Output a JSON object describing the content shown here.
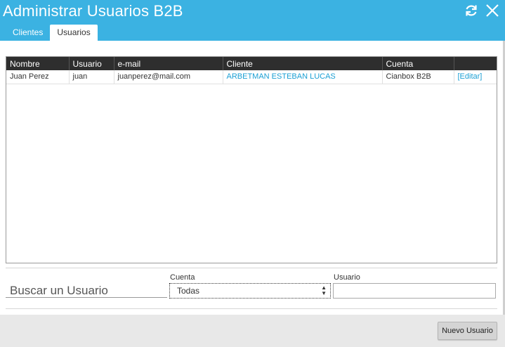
{
  "window": {
    "title": "Administrar Usuarios B2B"
  },
  "icons": {
    "refresh": "refresh-icon",
    "close": "close-icon"
  },
  "tabs": [
    {
      "label": "Clientes",
      "active": false
    },
    {
      "label": "Usuarios",
      "active": true
    }
  ],
  "grid": {
    "columns": [
      "Nombre",
      "Usuario",
      "e-mail",
      "Cliente",
      "Cuenta",
      ""
    ],
    "rows": [
      {
        "nombre": "Juan Perez",
        "usuario": "juan",
        "email": "juanperez@mail.com",
        "cliente": "ARBETMAN ESTEBAN LUCAS",
        "cuenta": "Cianbox B2B",
        "accion": "[Editar]"
      }
    ]
  },
  "search": {
    "label": "Buscar un Usuario",
    "cuenta_label": "Cuenta",
    "cuenta_value": "Todas",
    "usuario_label": "Usuario",
    "usuario_value": ""
  },
  "footer": {
    "nuevo_usuario": "Nuevo Usuario"
  },
  "colors": {
    "accent": "#3bb2e2",
    "link": "#1a9fd4",
    "header_bg": "#2e2e2e"
  }
}
